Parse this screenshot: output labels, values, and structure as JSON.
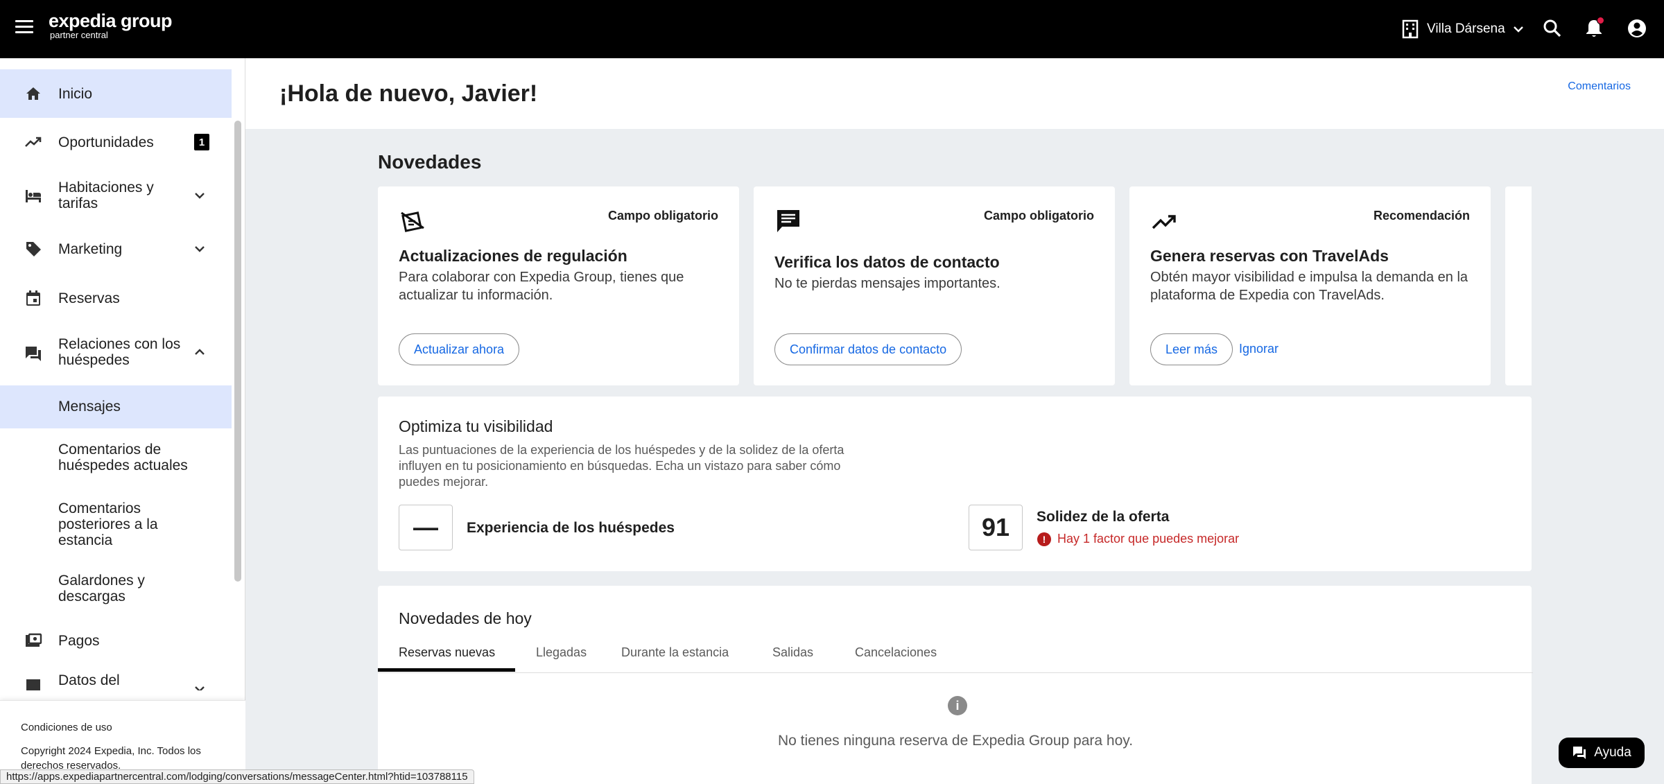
{
  "header": {
    "brand_line1": "expedia group",
    "brand_line2": "partner central",
    "property_name": "Villa Dársena"
  },
  "sidebar": {
    "items": [
      {
        "label": "Inicio",
        "icon": "home-icon",
        "active": true
      },
      {
        "label": "Oportunidades",
        "icon": "trending-icon",
        "badge": "1"
      },
      {
        "label": "Habitaciones y tarifas",
        "icon": "bed-icon",
        "expandable": true
      },
      {
        "label": "Marketing",
        "icon": "tag-icon",
        "expandable": true
      },
      {
        "label": "Reservas",
        "icon": "calendar-icon"
      },
      {
        "label": "Relaciones con los huéspedes",
        "icon": "chat-icon",
        "expanded": true
      },
      {
        "label": "Mensajes",
        "sub": true,
        "selected": true
      },
      {
        "label": "Comentarios de huéspedes actuales",
        "sub": true
      },
      {
        "label": "Comentarios posteriores a la estancia",
        "sub": true
      },
      {
        "label": "Galardones y descargas",
        "sub": true
      },
      {
        "label": "Pagos",
        "icon": "payments-icon"
      },
      {
        "label": "Datos del",
        "icon": "building-icon",
        "expandable": true
      }
    ],
    "footer": {
      "terms": "Condiciones de uso",
      "copyright": "Copyright 2024 Expedia, Inc. Todos los derechos reservados."
    }
  },
  "status_url": "https://apps.expediapartnercentral.com/lodging/conversations/messageCenter.html?htid=103788115",
  "main": {
    "greeting": "¡Hola de nuevo, Javier!",
    "feedback": "Comentarios",
    "news_title": "Novedades",
    "cards": [
      {
        "tag": "Campo obligatorio",
        "icon": "regulation-icon",
        "title": "Actualizaciones de regulación",
        "desc": "Para colaborar con Expedia Group, tienes que actualizar tu información.",
        "primary": "Actualizar ahora"
      },
      {
        "tag": "Campo obligatorio",
        "icon": "message-icon",
        "title": "Verifica los datos de contacto",
        "desc": "No te pierdas mensajes importantes.",
        "primary": "Confirmar datos de contacto"
      },
      {
        "tag": "Recomendación",
        "icon": "trending-up-icon",
        "title": "Genera reservas con TravelAds",
        "desc": "Obtén mayor visibilidad e impulsa la demanda en la plataforma de Expedia con TravelAds.",
        "primary": "Leer más",
        "secondary": "Ignorar"
      }
    ],
    "visibility": {
      "title": "Optimiza tu visibilidad",
      "desc": "Las puntuaciones de la experiencia de los huéspedes y de la solidez de la oferta influyen en tu posicionamiento en búsquedas. Echa un vistazo para saber cómo puedes mejorar.",
      "guest_score": "—",
      "guest_label": "Experiencia de los huéspedes",
      "offer_score": "91",
      "offer_label": "Solidez de la oferta",
      "offer_warning": "Hay 1 factor que puedes mejorar"
    },
    "today": {
      "title": "Novedades de hoy",
      "tabs": [
        "Reservas nuevas",
        "Llegadas",
        "Durante la estancia",
        "Salidas",
        "Cancelaciones"
      ],
      "active_tab": 0,
      "empty": "No tienes ninguna reserva de Expedia Group para hoy."
    },
    "help": "Ayuda"
  },
  "colors": {
    "accent": "#1668e3",
    "active_nav": "#dde6fd",
    "warning": "#c62828",
    "notification": "#e11d48"
  }
}
